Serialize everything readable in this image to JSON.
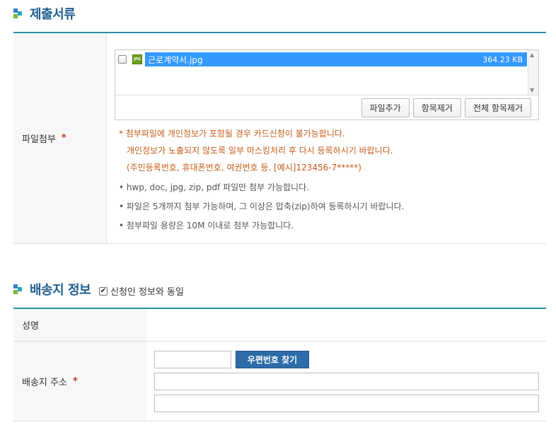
{
  "documents_section": {
    "title": "제출서류",
    "attach_label": "파일첨부",
    "required_mark": "*",
    "file": {
      "icon_text": "JPG",
      "name": "근로계약서.jpg",
      "size": "364.23 KB"
    },
    "buttons": {
      "add": "파일추가",
      "remove": "항목제거",
      "remove_all": "전체 항목제거"
    },
    "warnings": [
      "* 첨부파일에 개인정보가 포함될 경우 카드신청이 불가능합니다.",
      "개인정보가 노출되지 않도록 일부 마스킹처리 후 다시 등록하시기 바랍니다.",
      "(주민등록번호, 휴대폰번호, 여권번호 등. [예시]123456-7*****)"
    ],
    "notes": [
      "• hwp, doc, jpg, zip, pdf 파일만 첨부 가능합니다.",
      "• 파일은 5개까지 첨부 가능하며, 그 이상은 압축(zip)하여 등록하시기 바랍니다.",
      "• 첨부파일 용량은 10M 이내로 첨부 가능합니다."
    ]
  },
  "delivery_section": {
    "title": "배송지 정보",
    "same_as_applicant": {
      "checked": true,
      "check_mark": "✔",
      "label": "신청인 정보와 동일"
    },
    "name_label": "성명",
    "address_label": "배송지 주소",
    "required_mark": "*",
    "zip_button": "우편번호 찾기",
    "zipcode_value": "",
    "address1_value": "",
    "address2_value": ""
  },
  "colors": {
    "title": "#1f5f8f",
    "accent_line": "#2a8fa5",
    "selection": "#3399ff",
    "warning": "#c65b1a",
    "zip_button": "#2d6ca8"
  }
}
